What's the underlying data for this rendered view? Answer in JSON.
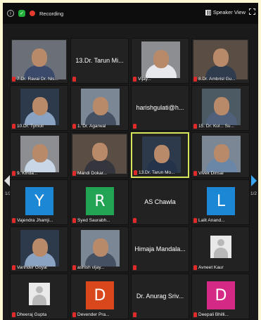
{
  "topbar": {
    "info_glyph": "i",
    "shield_glyph": "✓",
    "recording_label": "Recording",
    "speaker_view_label": "Speaker View"
  },
  "pager": {
    "left": "1/2",
    "right": "1/2"
  },
  "colors": {
    "page_bg": "#fdf7d3",
    "window_bg": "#1a1a1a",
    "active_border": "#d8e45a",
    "muted_mic": "#e02b2b",
    "avatar_blue": "#1c87d5",
    "avatar_green": "#23a455",
    "avatar_orange": "#d9481c",
    "avatar_pink": "#d42a86"
  },
  "tiles": [
    {
      "kind": "video",
      "name": "7.Dr. Ravai Dr. Nis...",
      "muted": true
    },
    {
      "kind": "text",
      "title": "13.Dr. Tarun Mi...",
      "name": "",
      "muted": true
    },
    {
      "kind": "video",
      "name": "Vijay...",
      "muted": true
    },
    {
      "kind": "video",
      "name": "8.Dr. Ambrisl Gu...",
      "muted": true
    },
    {
      "kind": "video",
      "name": "10.Dr. Tymoll",
      "muted": true
    },
    {
      "kind": "video",
      "name": "1. Dr. Agarwal",
      "muted": true
    },
    {
      "kind": "text",
      "title": "harishgulati@h...",
      "name": "",
      "muted": true
    },
    {
      "kind": "video",
      "name": "15. Dr. Kul... Su...",
      "muted": true
    },
    {
      "kind": "video",
      "name": "9. Kinda...",
      "muted": true
    },
    {
      "kind": "video",
      "name": "Mandi Dokar...",
      "muted": true
    },
    {
      "kind": "video",
      "name": "13.Dr. Tarun Mo...",
      "muted": true,
      "active": true
    },
    {
      "kind": "video",
      "name": "Vivek Dinsai",
      "muted": true
    },
    {
      "kind": "letter",
      "letter": "Y",
      "color": "#1c87d5",
      "name": "Vajendra Jhamji...",
      "muted": true
    },
    {
      "kind": "letter",
      "letter": "R",
      "color": "#23a455",
      "name": "Syed Saurabh...",
      "muted": true
    },
    {
      "kind": "text",
      "title": "AS Chawla",
      "name": "",
      "muted": true
    },
    {
      "kind": "letter",
      "letter": "L",
      "color": "#1c87d5",
      "name": "Lalit Anand...",
      "muted": true
    },
    {
      "kind": "video",
      "name": "Varinder Goyal",
      "muted": true
    },
    {
      "kind": "video",
      "name": "ashish vijay...",
      "muted": true
    },
    {
      "kind": "text",
      "title": "Himaja Mandala...",
      "name": "",
      "muted": true
    },
    {
      "kind": "avatar",
      "name": "Avneet Kaur",
      "muted": true
    },
    {
      "kind": "avatar",
      "name": "Dheeraj Gupta",
      "muted": true
    },
    {
      "kind": "letter",
      "letter": "D",
      "color": "#d9481c",
      "name": "Devender Pra...",
      "muted": true
    },
    {
      "kind": "text",
      "title": "Dr. Anurag Sriv...",
      "name": "",
      "muted": true
    },
    {
      "kind": "letter",
      "letter": "D",
      "color": "#d42a86",
      "name": "Deepali Bhilli...",
      "muted": true
    }
  ]
}
